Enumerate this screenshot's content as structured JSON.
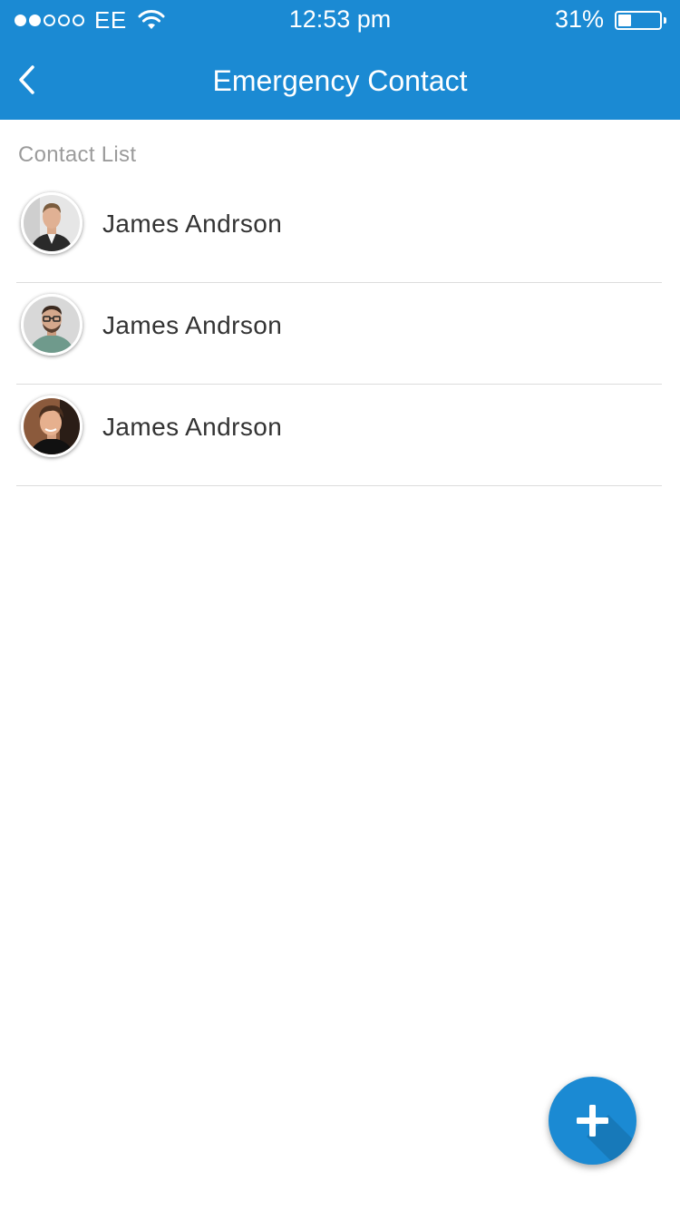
{
  "status_bar": {
    "carrier": "EE",
    "time": "12:53 pm",
    "battery": "31%",
    "battery_level": 0.31,
    "signal_bars": 2,
    "signal_total": 5
  },
  "nav": {
    "title": "Emergency Contact",
    "back_icon": "chevron-left-icon"
  },
  "section": {
    "label": "Contact List"
  },
  "contacts": [
    {
      "name": "James Andrson"
    },
    {
      "name": "James Andrson"
    },
    {
      "name": "James Andrson"
    }
  ],
  "fab": {
    "icon": "plus-icon"
  },
  "colors": {
    "primary": "#1b8ad3",
    "text": "#333333",
    "muted": "#9b9b9b",
    "divider": "#dcdcdc"
  }
}
